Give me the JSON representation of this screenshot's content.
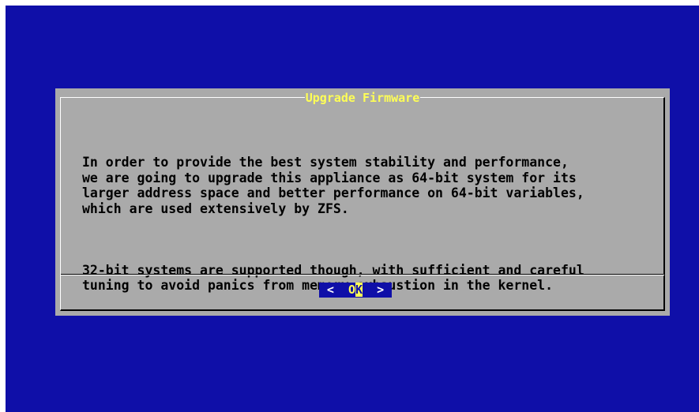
{
  "dialog": {
    "title": "Upgrade Firmware",
    "paragraph1": "In order to provide the best system stability and performance,\nwe are going to upgrade this appliance as 64-bit system for its\nlarger address space and better performance on 64-bit variables,\nwhich are used extensively by ZFS.",
    "paragraph2": "32-bit systems are supported though, with sufficient and careful\ntuning to avoid panics from memory exhaustion in the kernel."
  },
  "buttons": {
    "ok_left": "<  ",
    "ok_hot": "O",
    "ok_cursor": "K",
    "ok_right": "  >"
  },
  "colors": {
    "background": "#0f0fa8",
    "dialog": "#aaaaaa",
    "title": "#ffff55"
  }
}
